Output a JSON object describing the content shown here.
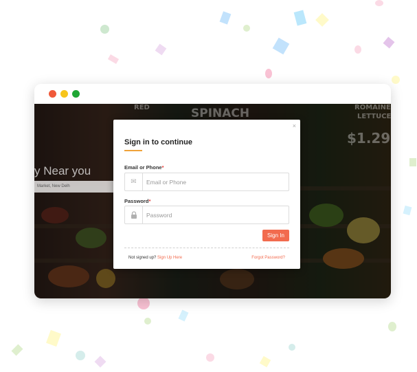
{
  "window": {
    "controls": [
      "close-dot",
      "minimize-dot",
      "maximize-dot"
    ],
    "colors": {
      "close": "#f0593a",
      "minimize": "#f7c51b",
      "maximize": "#1fa735"
    }
  },
  "background_page": {
    "hero_text": "y Near you",
    "search_text": "Market, New Delh",
    "signs": [
      "SPINACH",
      "ROMAINE",
      "LETTUCE",
      "$1.29",
      "RED"
    ]
  },
  "modal": {
    "close_label": "×",
    "title": "Sign in to continue",
    "email": {
      "label": "Email or Phone",
      "required": "*",
      "placeholder": "Email or Phone",
      "value": "",
      "icon": "envelope-icon"
    },
    "password": {
      "label": "Password",
      "required": "*",
      "placeholder": "Password",
      "value": "",
      "icon": "lock-icon"
    },
    "submit_label": "Sign In",
    "signup_prompt": "Not signed up?",
    "signup_link": "Sign Up Here",
    "forgot_link": "Forgot Password?",
    "accent_color": "#f26b4e",
    "underline_color": "#f0a23a"
  }
}
